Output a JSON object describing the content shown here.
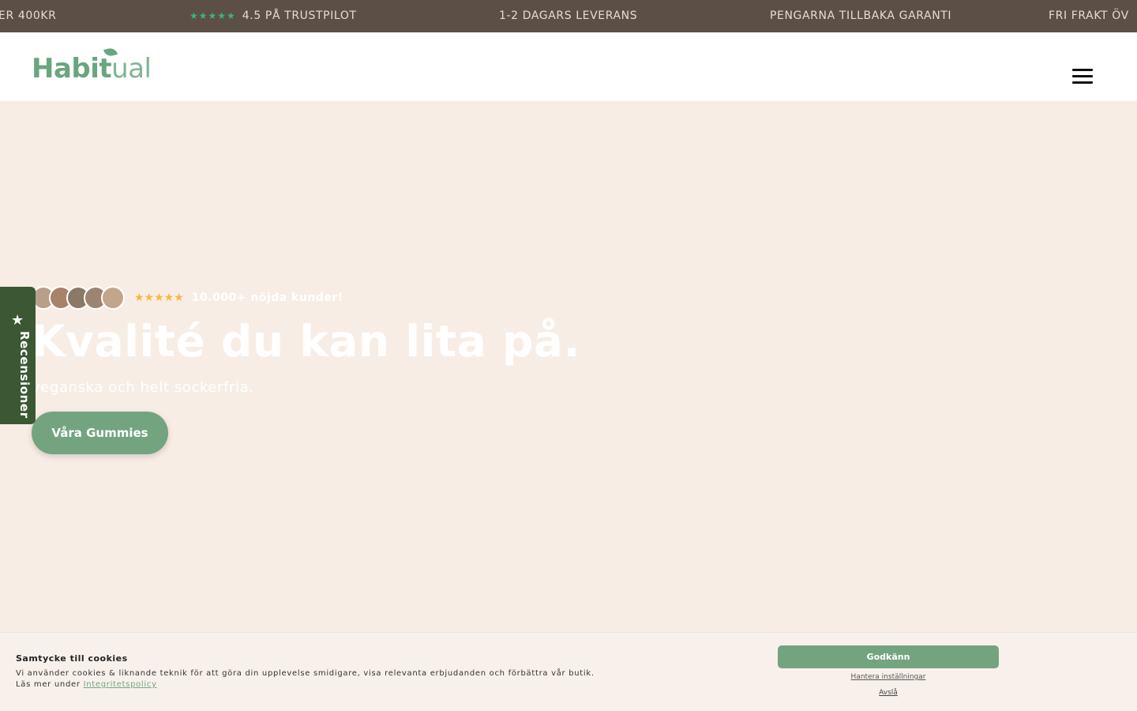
{
  "ticker": {
    "items": [
      "ER 400KR",
      "4.5 PÅ TRUSTPILOT",
      "1-2 DAGARS LEVERANS",
      "PENGARNA TILLBAKA GARANTI",
      "FRI FRAKT ÖV"
    ],
    "stars": "★★★★★",
    "star_color": "#3fb37a"
  },
  "header": {
    "logo_bold": "Habit",
    "logo_light": "ual",
    "menu_icon": "hamburger-menu-icon"
  },
  "hero": {
    "rating_stars": "★★★★★",
    "social_proof": "10.000+ nöjda kunder!",
    "title": "Kvalité du kan lita på.",
    "subtitle": "veganska och helt sockerfria.",
    "cta_label": "Våra Gummies",
    "accent_color": "#73a47f",
    "avatar_colors": [
      "#b79f8a",
      "#a9826a",
      "#8a7868",
      "#9c8472",
      "#c2a68c"
    ]
  },
  "reviews_tab": {
    "icon": "star-icon",
    "star": "★",
    "label": "Recensioner"
  },
  "cookie": {
    "title": "Samtycke till cookies",
    "text": "Vi använder cookies & liknande teknik för att göra din upplevelse smidigare, visa relevanta erbjudanden och förbättra vår butik.",
    "read_more": "Läs mer under",
    "policy_link": "Integritetspolicy",
    "accept": "Godkänn",
    "manage": "Hantera inställningar",
    "decline": "Avslå"
  }
}
